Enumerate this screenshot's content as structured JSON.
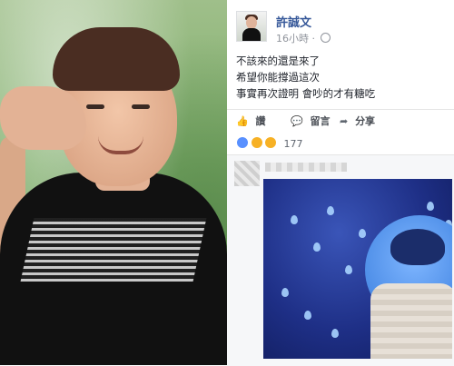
{
  "post": {
    "author": "許誠文",
    "timestamp": "16小時",
    "lines": [
      "不該來的還是來了",
      "希望你能撐過這次",
      "事實再次證明 會吵的才有糖吃"
    ]
  },
  "actions": {
    "like_label": "讚",
    "comment_label": "留言",
    "share_label": "分享"
  },
  "reactions": {
    "count": "177"
  },
  "icons": {
    "globe": "globe-icon",
    "like": "thumbs-up-icon",
    "comment": "comment-icon",
    "share": "share-icon"
  },
  "colors": {
    "author": "#365899",
    "meta": "#90949c",
    "text": "#1d2129"
  }
}
